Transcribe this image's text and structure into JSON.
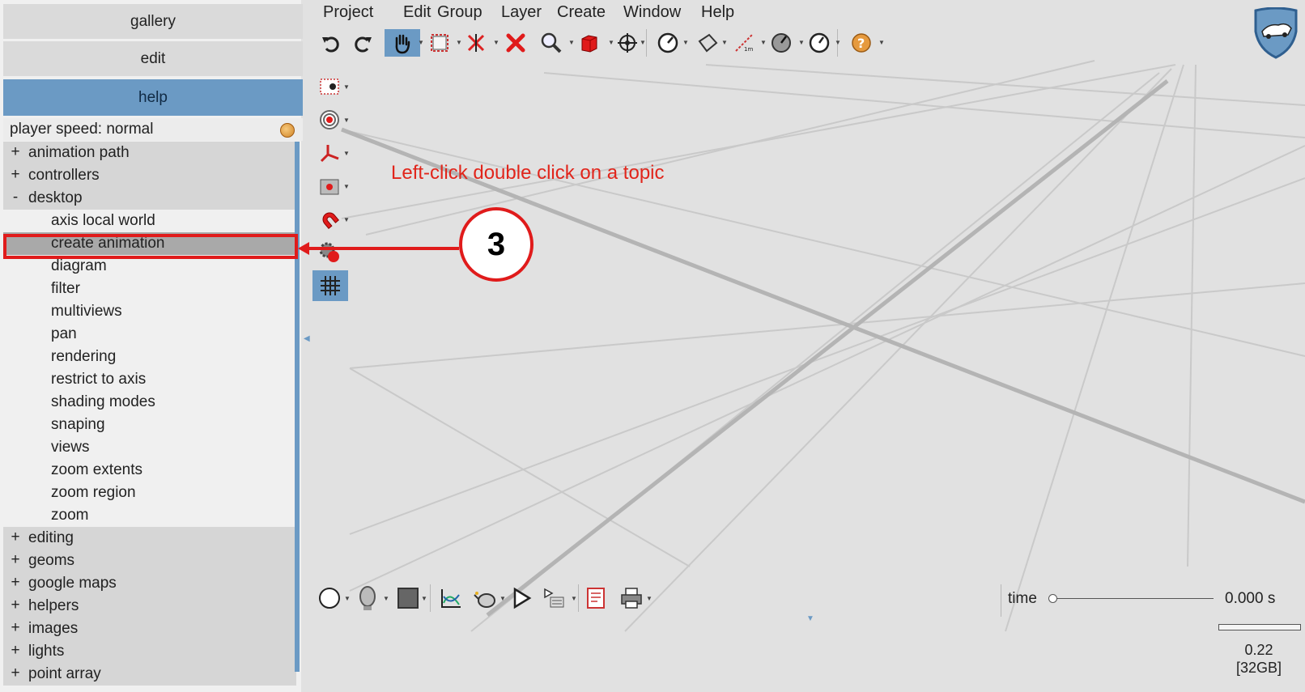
{
  "left_panel": {
    "gallery_label": "gallery",
    "edit_label": "edit",
    "help_label": "help",
    "player_speed": "player speed: normal",
    "tree": {
      "groups_top": [
        {
          "sign": "+",
          "label": "animation path"
        },
        {
          "sign": "+",
          "label": "controllers"
        },
        {
          "sign": "-",
          "label": "desktop"
        }
      ],
      "desktop_children": [
        "axis local world",
        "create animation",
        "diagram",
        "filter",
        "multiviews",
        "pan",
        "rendering",
        "restrict to axis",
        "shading modes",
        "snaping",
        "views",
        "zoom extents",
        "zoom region",
        "zoom"
      ],
      "groups_bottom": [
        {
          "sign": "+",
          "label": "editing"
        },
        {
          "sign": "+",
          "label": "geoms"
        },
        {
          "sign": "+",
          "label": "google maps"
        },
        {
          "sign": "+",
          "label": "helpers"
        },
        {
          "sign": "+",
          "label": "images"
        },
        {
          "sign": "+",
          "label": "lights"
        },
        {
          "sign": "+",
          "label": "point array"
        }
      ],
      "selected": "create animation"
    }
  },
  "menubar": [
    "Project",
    "Edit",
    "Group",
    "Layer",
    "Create",
    "Window",
    "Help"
  ],
  "annotation": {
    "instruction": "Left-click double click on a topic",
    "step_number": "3"
  },
  "timeline": {
    "label": "time",
    "value": "0.000 s"
  },
  "status": {
    "line1": "0.22",
    "line2": "[32GB]"
  },
  "icons": {
    "top_toolbar": [
      "undo-icon",
      "redo-icon",
      "pan-hand-icon",
      "select-rectangle-icon",
      "delete-selection-icon",
      "delete-icon",
      "zoom-icon",
      "red-cube-icon",
      "move-icon",
      "rotate-icon",
      "paper-icon",
      "measure-icon",
      "speed-icon",
      "clock-icon",
      "help-icon"
    ],
    "left_toolbar": [
      "snap-point-icon",
      "target-icon",
      "axis-icon",
      "camera-icon",
      "magnet-icon",
      "settings-record-icon",
      "grid-icon"
    ],
    "bottom_toolbar": [
      "sphere-icon",
      "head-icon",
      "square-icon",
      "graph-icon",
      "teapot-icon",
      "play-icon",
      "playlist-icon",
      "report-icon",
      "print-icon"
    ]
  },
  "colors": {
    "accent": "#6b9ac4",
    "annotation_red": "#e01b1b",
    "panel_bg": "#f0f0f0",
    "viewport_bg": "#e1e1e1"
  }
}
